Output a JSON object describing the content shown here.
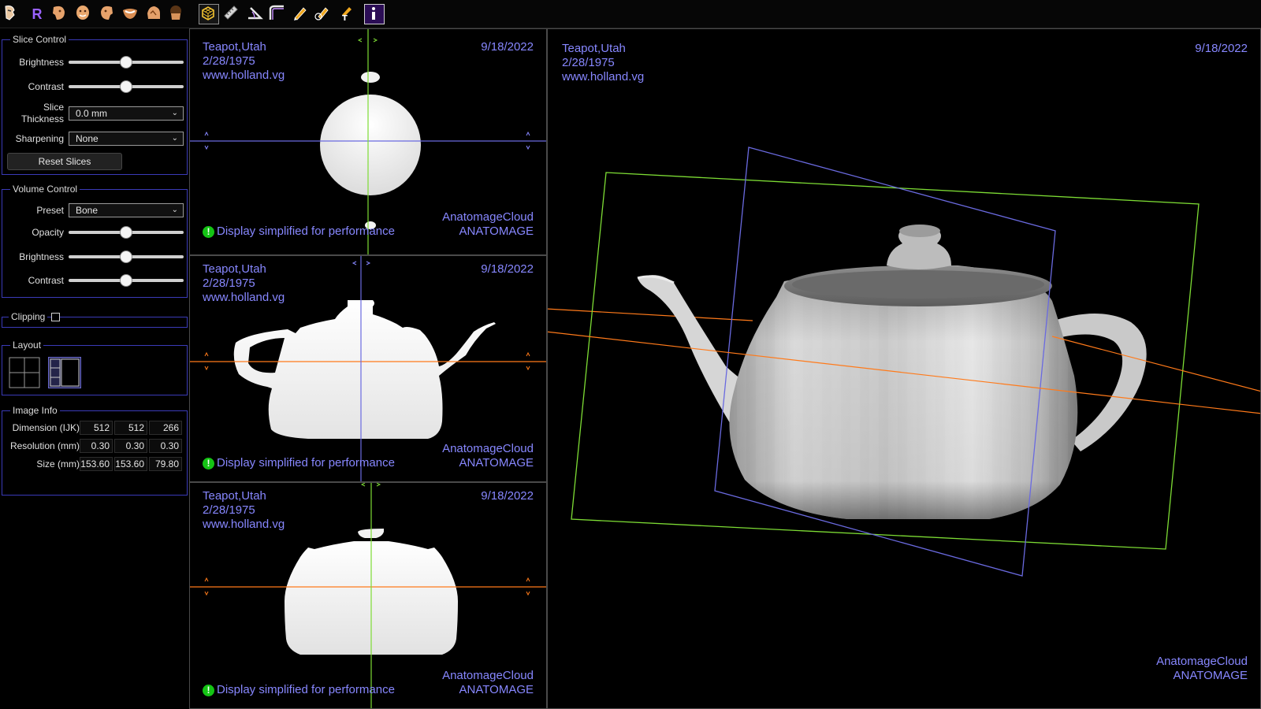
{
  "slice_control": {
    "title": "Slice Control",
    "brightness_label": "Brightness",
    "brightness_value": 0.5,
    "contrast_label": "Contrast",
    "contrast_value": 0.5,
    "thickness_label_1": "Slice",
    "thickness_label_2": "Thickness",
    "thickness_value": "0.0 mm",
    "sharpening_label": "Sharpening",
    "sharpening_value": "None",
    "reset_label": "Reset Slices"
  },
  "volume_control": {
    "title": "Volume Control",
    "preset_label": "Preset",
    "preset_value": "Bone",
    "opacity_label": "Opacity",
    "opacity_value": 0.5,
    "brightness_label": "Brightness",
    "brightness_value": 0.5,
    "contrast_label": "Contrast",
    "contrast_value": 0.5
  },
  "clipping": {
    "title": "Clipping",
    "checked": false
  },
  "layout": {
    "title": "Layout"
  },
  "image_info": {
    "title": "Image Info",
    "rows": [
      {
        "label": "Dimension (IJK)",
        "values": [
          "512",
          "512",
          "266"
        ]
      },
      {
        "label": "Resolution (mm)",
        "values": [
          "0.30",
          "0.30",
          "0.30"
        ]
      },
      {
        "label": "Size (mm)",
        "values": [
          "153.60",
          "153.60",
          "79.80"
        ]
      }
    ]
  },
  "viewer": {
    "patient_name": "Teapot,Utah",
    "patient_dob": "2/28/1975",
    "website": "www.holland.vg",
    "date": "9/18/2022",
    "brand_1": "AnatomageCloud",
    "brand_2": "ANATOMAGE",
    "notice": "Display simplified for performance"
  },
  "toolbar": {
    "r_label": "R",
    "icons": [
      "dental-lateral-view-icon",
      "face-left-icon",
      "face-front-icon",
      "face-right-icon",
      "jaw-bottom-icon",
      "skull-icon",
      "head-back-icon",
      "volume-render-icon",
      "ruler-icon",
      "angle-icon",
      "curve-icon",
      "pen-icon",
      "pen-area-icon",
      "text-annotation-icon",
      "info-icon"
    ]
  },
  "colors": {
    "accent_blue": "#8787ff",
    "slice_green": "#7ddc34",
    "slice_orange": "#ff7a1a",
    "notice_green": "#14c414"
  }
}
